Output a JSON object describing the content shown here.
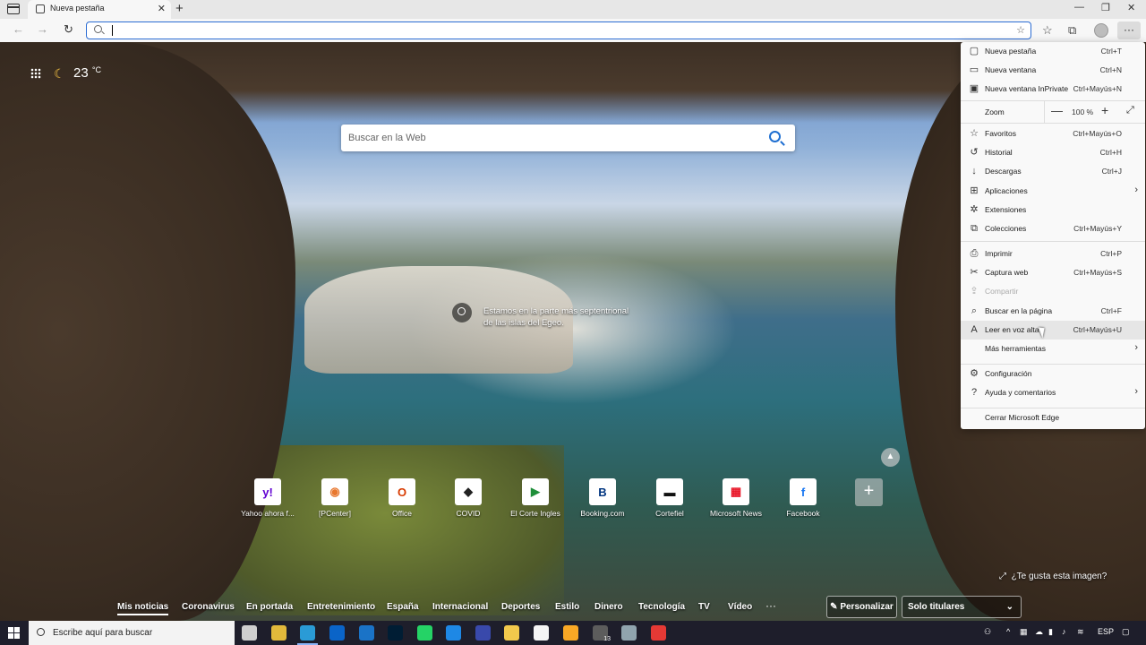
{
  "browser": {
    "tab_title": "Nueva pestaña",
    "new_tab_glyph": "+",
    "close_glyph": "✕",
    "window_controls": [
      "—",
      "❐",
      "✕"
    ],
    "address_value": "",
    "menu_glyph": "···"
  },
  "newtab": {
    "weather_temp": "23",
    "weather_unit": "°C",
    "search_placeholder": "Buscar en la Web",
    "image_caption": "Estamos en la parte más septentrional de las islas del Egeo.",
    "like_image": "¿Te gusta esta imagen?",
    "tiles": [
      {
        "label": "Yahoo ahora f...",
        "glyph": "y!",
        "color": "#6001d2"
      },
      {
        "label": "[PCenter]",
        "glyph": "◉",
        "color": "#e8772e"
      },
      {
        "label": "Office",
        "glyph": "O",
        "color": "#d83b01"
      },
      {
        "label": "COVID",
        "glyph": "◆",
        "color": "#222222"
      },
      {
        "label": "El Corte Ingles",
        "glyph": "▶",
        "color": "#1f8f3a"
      },
      {
        "label": "Booking.com",
        "glyph": "B",
        "color": "#003580"
      },
      {
        "label": "Cortefiel",
        "glyph": "▬",
        "color": "#111111"
      },
      {
        "label": "Microsoft News",
        "glyph": "▦",
        "color": "#e81123"
      },
      {
        "label": "Facebook",
        "glyph": "f",
        "color": "#1877f2"
      }
    ],
    "add_tile_glyph": "+",
    "news_tabs": [
      "Mis noticias",
      "Coronavirus",
      "En portada",
      "Entretenimiento",
      "España",
      "Internacional",
      "Deportes",
      "Estilo",
      "Dinero",
      "Tecnología",
      "TV",
      "Vídeo"
    ],
    "news_more": "···",
    "personalize": "✎ Personalizar",
    "layout_select": "Solo titulares"
  },
  "menu": {
    "items_top": [
      {
        "label": "Nueva pestaña",
        "shortcut": "Ctrl+T",
        "icon": "▢"
      },
      {
        "label": "Nueva ventana",
        "shortcut": "Ctrl+N",
        "icon": "▭"
      },
      {
        "label": "Nueva ventana InPrivate",
        "shortcut": "Ctrl+Mayús+N",
        "icon": "▣"
      }
    ],
    "zoom": {
      "label": "Zoom",
      "value": "100 %",
      "minus": "—",
      "plus": "+",
      "full": "⤢"
    },
    "items_mid": [
      {
        "label": "Favoritos",
        "shortcut": "Ctrl+Mayús+O",
        "icon": "☆"
      },
      {
        "label": "Historial",
        "shortcut": "Ctrl+H",
        "icon": "↺"
      },
      {
        "label": "Descargas",
        "shortcut": "Ctrl+J",
        "icon": "↓"
      },
      {
        "label": "Aplicaciones",
        "shortcut": "",
        "icon": "⊞",
        "arrow": "›"
      },
      {
        "label": "Extensiones",
        "shortcut": "",
        "icon": "✲"
      },
      {
        "label": "Colecciones",
        "shortcut": "Ctrl+Mayús+Y",
        "icon": "⧉"
      }
    ],
    "items_tools": [
      {
        "label": "Imprimir",
        "shortcut": "Ctrl+P",
        "icon": "⎙"
      },
      {
        "label": "Captura web",
        "shortcut": "Ctrl+Mayús+S",
        "icon": "✂"
      },
      {
        "label": "Compartir",
        "shortcut": "",
        "icon": "⇪",
        "disabled": true
      },
      {
        "label": "Buscar en la página",
        "shortcut": "Ctrl+F",
        "icon": "⌕"
      },
      {
        "label": "Leer en voz alta",
        "shortcut": "Ctrl+Mayús+U",
        "icon": "A",
        "hover": true
      },
      {
        "label": "Más herramientas",
        "shortcut": "",
        "icon": "",
        "arrow": "›"
      }
    ],
    "items_settings": [
      {
        "label": "Configuración",
        "shortcut": "",
        "icon": "⚙"
      },
      {
        "label": "Ayuda y comentarios",
        "shortcut": "",
        "icon": "?",
        "arrow": "›"
      }
    ],
    "close_label": "Cerrar Microsoft Edge"
  },
  "taskbar": {
    "search_text": "Escribe aquí para buscar",
    "apps": [
      {
        "name": "task-view",
        "color": "#cfcfcf"
      },
      {
        "name": "chrome",
        "color": "#e2b93b"
      },
      {
        "name": "edge",
        "color": "#2a9bd6",
        "running": true
      },
      {
        "name": "outlook",
        "color": "#0a64c8"
      },
      {
        "name": "skype-app",
        "color": "#1a73c7"
      },
      {
        "name": "photoshop",
        "color": "#001d34"
      },
      {
        "name": "whatsapp",
        "color": "#25d366"
      },
      {
        "name": "drawing-app",
        "color": "#1e88e5"
      },
      {
        "name": "shield-app",
        "color": "#3949ab"
      },
      {
        "name": "pinwheel-app",
        "color": "#f5f5f5"
      },
      {
        "name": "weather-app",
        "color": "#f9a825"
      },
      {
        "name": "file-explorer",
        "color": "#f2c94c"
      },
      {
        "name": "calculator",
        "color": "#5c5c5c",
        "badge": "13"
      },
      {
        "name": "plane-app",
        "color": "#90a4ae"
      },
      {
        "name": "media-app",
        "color": "#e53935"
      }
    ],
    "tray_lang": "ESP"
  }
}
